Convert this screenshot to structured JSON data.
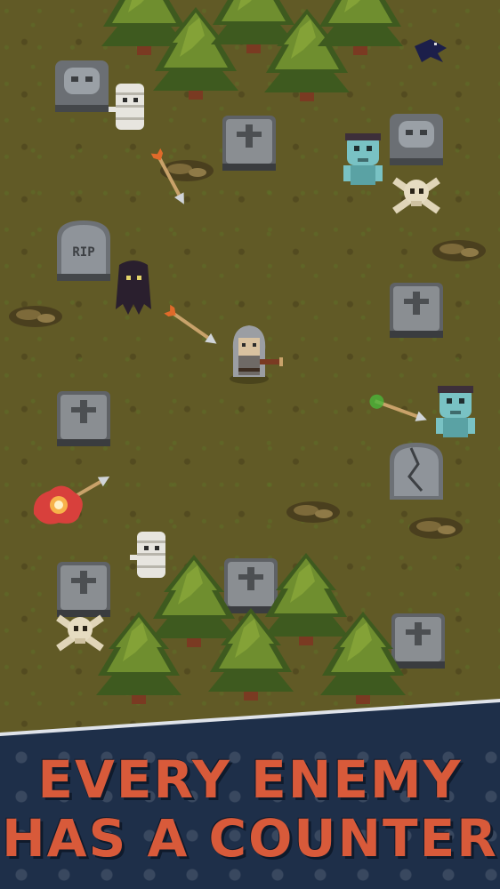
{
  "headline": {
    "line1": "EVERY ENEMY",
    "line2": "HAS A COUNTER"
  },
  "tombstone": {
    "rip_text": "RIP"
  },
  "colors": {
    "ground": "#615a26",
    "tree_dark": "#3e5a1f",
    "tree_light": "#6f8e2f",
    "banner": "#1e2f49",
    "headline": "#d85a3a"
  }
}
